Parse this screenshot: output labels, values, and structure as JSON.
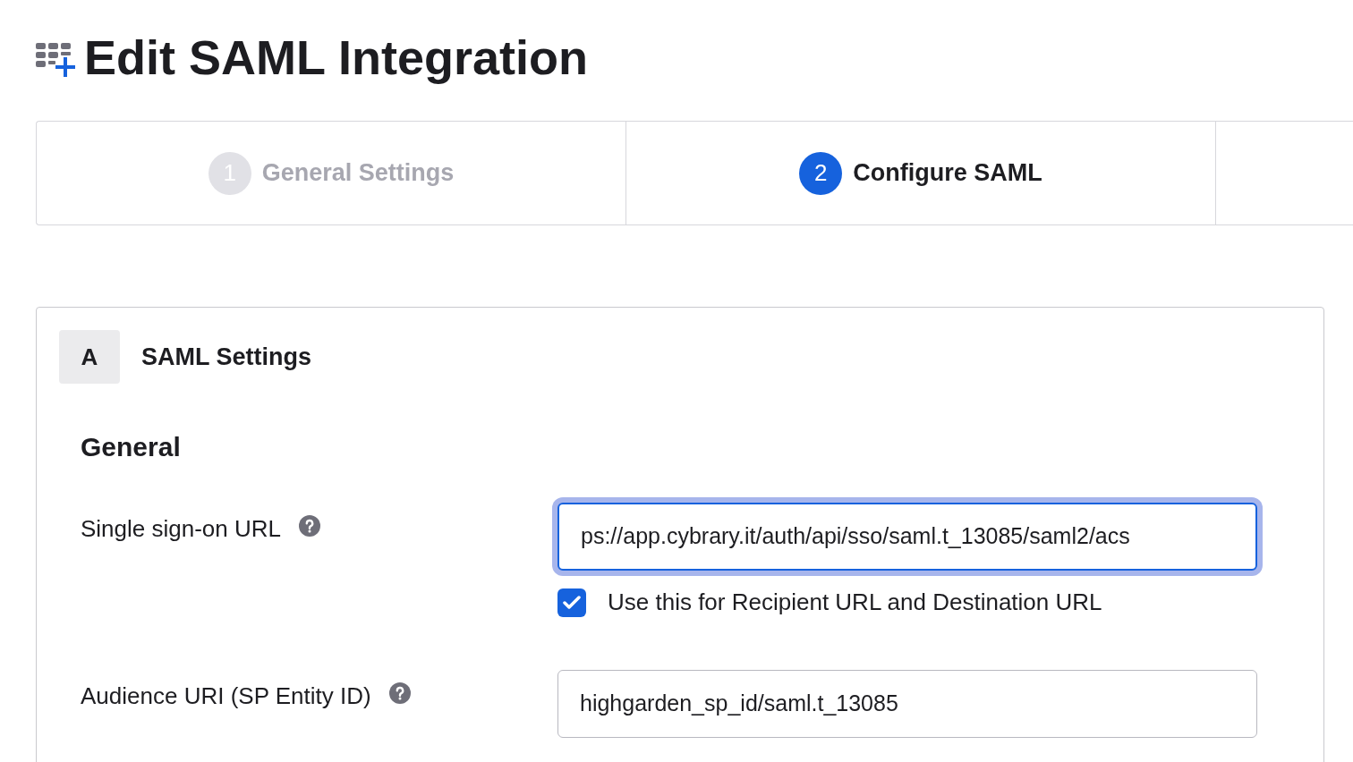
{
  "page": {
    "title": "Edit SAML Integration"
  },
  "steps": [
    {
      "number": "1",
      "label": "General Settings",
      "selected": false
    },
    {
      "number": "2",
      "label": "Configure SAML",
      "selected": true
    }
  ],
  "section": {
    "letter": "A",
    "title": "SAML Settings",
    "heading": "General",
    "fields": [
      {
        "label": "Single sign-on URL",
        "value": "ps://app.cybrary.it/auth/api/sso/saml.t_13085/saml2/acs",
        "focused": true,
        "checkbox": {
          "label": "Use this for Recipient URL and Destination URL",
          "checked": true
        }
      },
      {
        "label": "Audience URI (SP Entity ID)",
        "value": "highgarden_sp_id/saml.t_13085",
        "focused": false
      }
    ]
  }
}
